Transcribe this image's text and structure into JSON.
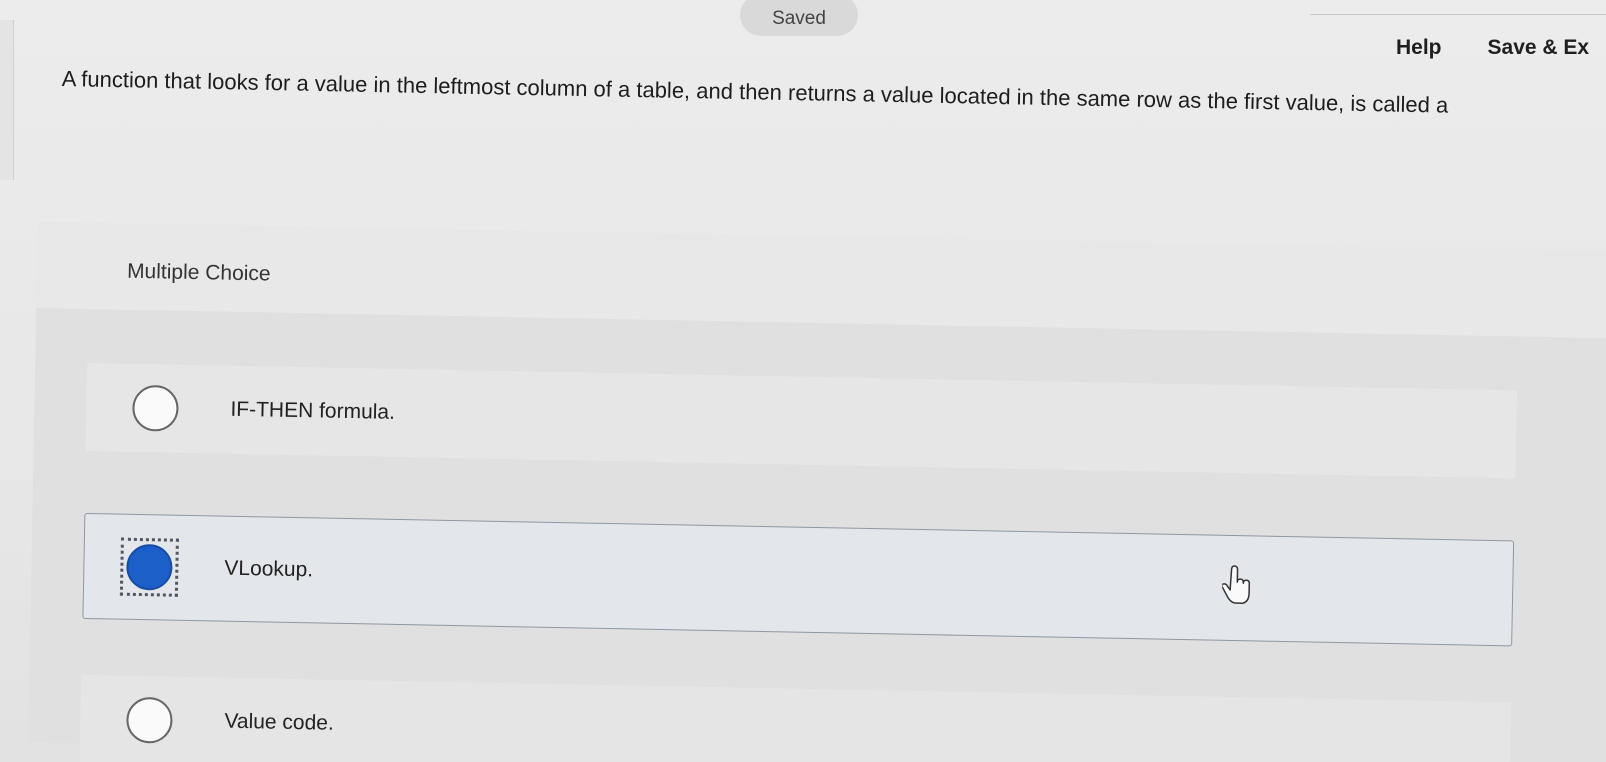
{
  "header": {
    "status": "Saved",
    "help_label": "Help",
    "save_exit_label": "Save & Ex"
  },
  "question": {
    "text": "A function that looks for a value in the leftmost column of a table, and then returns a value located in the same row as the first value, is called a"
  },
  "choices": {
    "heading": "Multiple Choice",
    "options": [
      {
        "label": "IF-THEN formula.",
        "selected": false
      },
      {
        "label": "VLookup.",
        "selected": true
      },
      {
        "label": "Value code.",
        "selected": false
      }
    ]
  },
  "colors": {
    "selected_radio": "#1d5fc9",
    "selected_border": "#8e98a3"
  }
}
